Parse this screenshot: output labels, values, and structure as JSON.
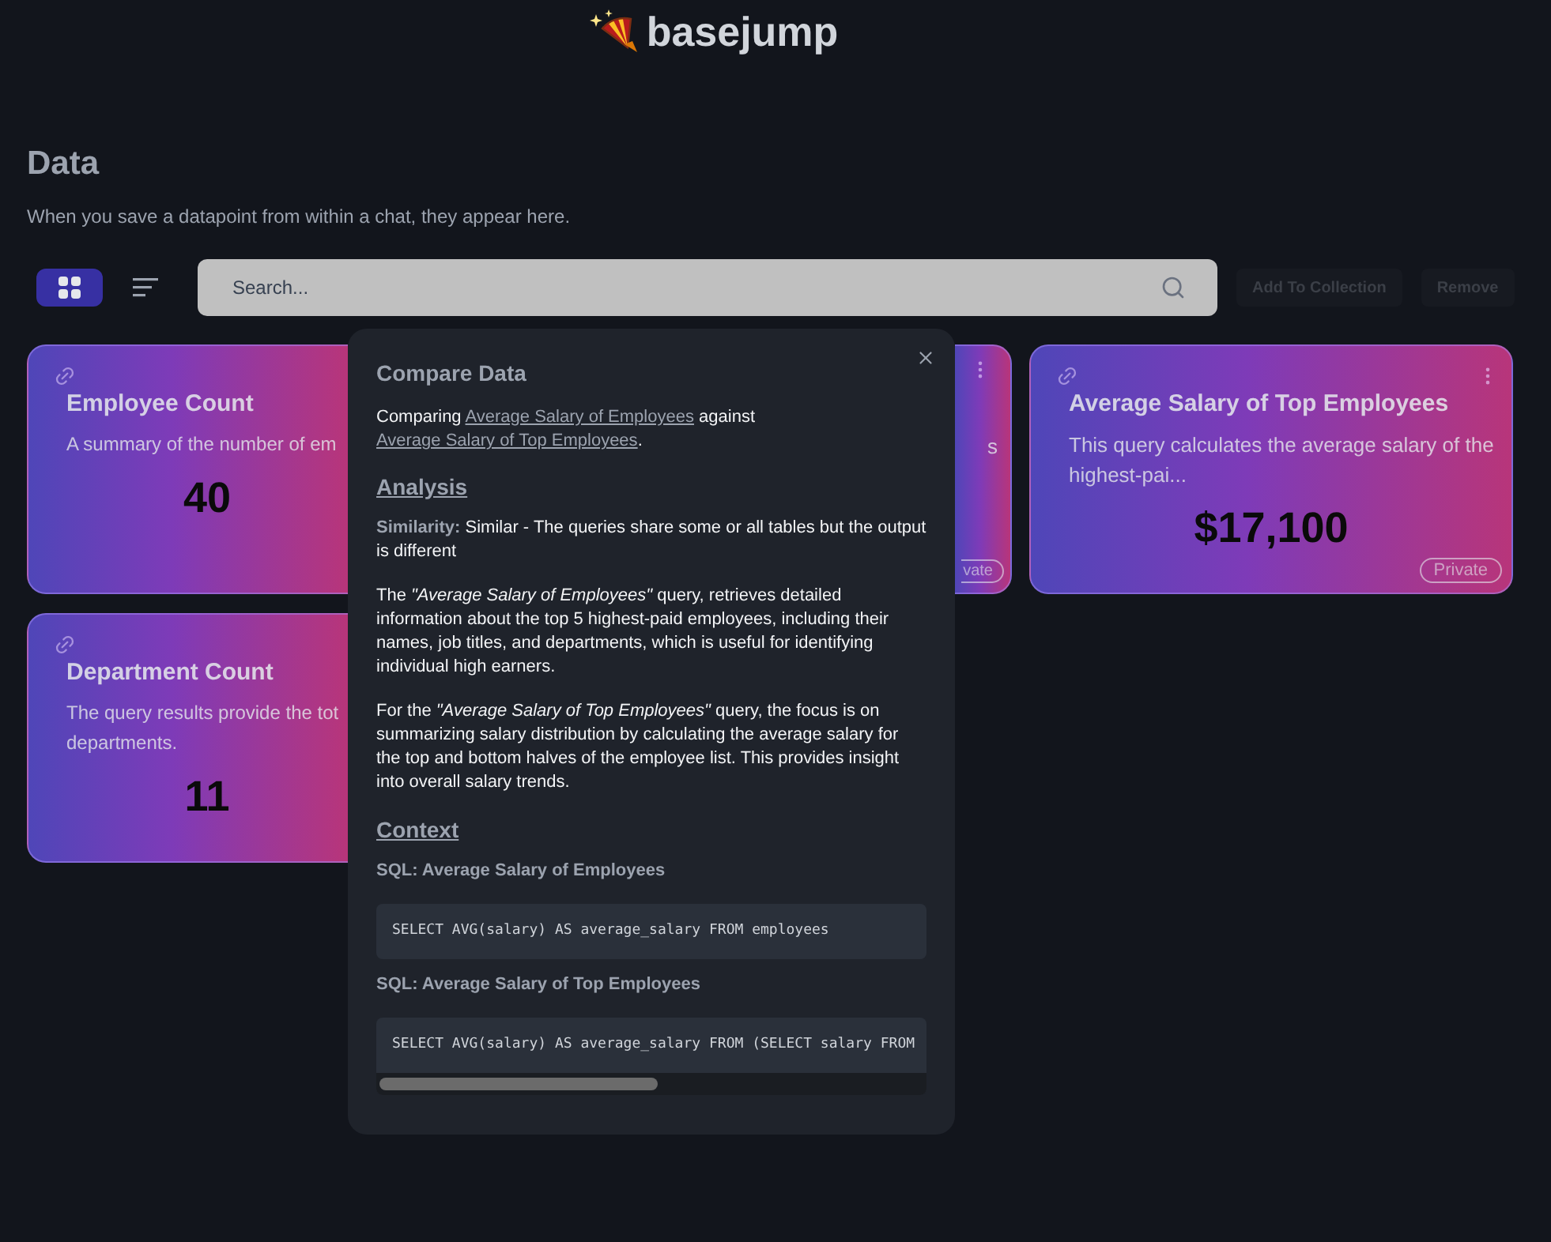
{
  "logo": {
    "text": "basejump"
  },
  "header": {
    "title": "Data",
    "subtitle": "When you save a datapoint from within a chat, they appear here."
  },
  "view_toggle": [
    {
      "kind": "grid",
      "selected": true
    },
    {
      "kind": "list",
      "selected": false
    }
  ],
  "search": {
    "placeholder": "Search..."
  },
  "actions": [
    {
      "label": "Add To Collection",
      "disabled": true
    },
    {
      "label": "Remove",
      "disabled": true
    }
  ],
  "cards": [
    {
      "title": "Employee Count",
      "description_lines": [
        "A summary of the number of em"
      ],
      "value": "40"
    },
    {
      "description_lines": [
        "s"
      ],
      "badge": "vate"
    },
    {
      "title": "Average Salary of Top Employees",
      "description_lines": [
        "This query calculates the average salary of the",
        "highest-pai..."
      ],
      "value": "$17,100",
      "badge": "Private"
    },
    {
      "title": "Department Count",
      "description_lines": [
        "The query results provide the tot",
        "departments."
      ],
      "value": "11"
    }
  ],
  "modal": {
    "title": "Compare Data",
    "intro": {
      "prefix": "Comparing",
      "link_1": "Average Salary of Employees",
      "middle": "against",
      "link_2": "Average Salary of Top Employees",
      "suffix": "."
    },
    "analysis_heading": "Analysis",
    "similarity": {
      "label": "Similarity:",
      "text": "Similar - The queries share some or all tables but the output is different"
    },
    "paragraphs": [
      "The *\"Average Salary of Employees\"* query, retrieves detailed information about the top 5 highest-paid employees, including their names, job titles, and departments, which is useful for identifying individual high earners.",
      "For the *\"Average Salary of Top Employees\"* query, the focus is on summarizing salary distribution by calculating the average salary for the top and bottom halves of the employee list. This provides insight into overall salary trends."
    ],
    "context_heading": "Context",
    "sql": [
      {
        "label": "SQL: Average Salary of Employees",
        "code": "SELECT AVG(salary) AS average_salary FROM employees",
        "scrollbar": false
      },
      {
        "label": "SQL: Average Salary of Top Employees",
        "code": "SELECT AVG(salary) AS average_salary FROM (SELECT salary FROM",
        "scrollbar": true
      }
    ]
  }
}
